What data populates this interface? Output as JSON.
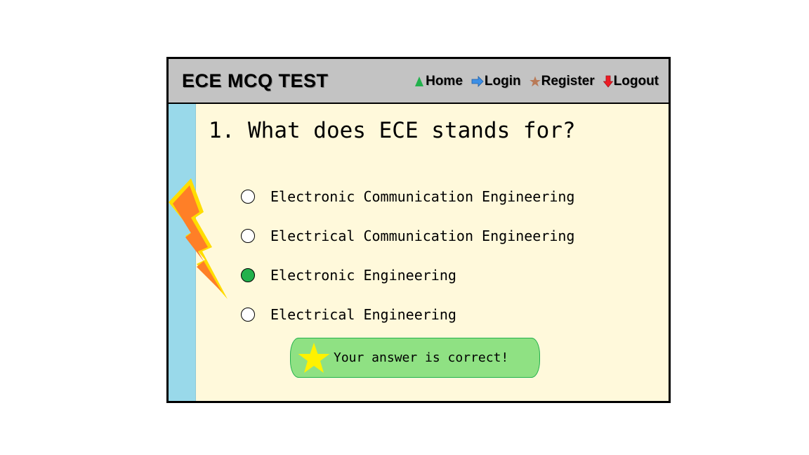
{
  "header": {
    "title": "ECE MCQ TEST",
    "nav": [
      {
        "label": "Home",
        "icon": "green-up-triangle-icon",
        "color": "#22b14c"
      },
      {
        "label": "Login",
        "icon": "blue-right-arrow-icon",
        "color": "#3c8fe6"
      },
      {
        "label": "Register",
        "icon": "brown-star-icon",
        "color": "#b97a57"
      },
      {
        "label": "Logout",
        "icon": "red-down-arrow-icon",
        "color": "#ed1c24"
      }
    ]
  },
  "question": {
    "text": "1. What does ECE stands for?",
    "options": [
      {
        "label": "Electronic Communication Engineering",
        "selected": false
      },
      {
        "label": "Electrical Communication Engineering",
        "selected": false
      },
      {
        "label": "Electronic Engineering",
        "selected": true
      },
      {
        "label": "Electrical Engineering",
        "selected": false
      }
    ]
  },
  "result": {
    "text": "Your answer is correct!",
    "icon": "yellow-star-icon"
  },
  "colors": {
    "header_bg": "#c3c3c3",
    "content_bg": "#fff9db",
    "sidebar_bg": "#99d9ea",
    "selected_radio": "#22b14c",
    "result_bg": "#8fe183",
    "bolt_fill": "#ff7f27",
    "bolt_outline": "#ffdd00"
  }
}
